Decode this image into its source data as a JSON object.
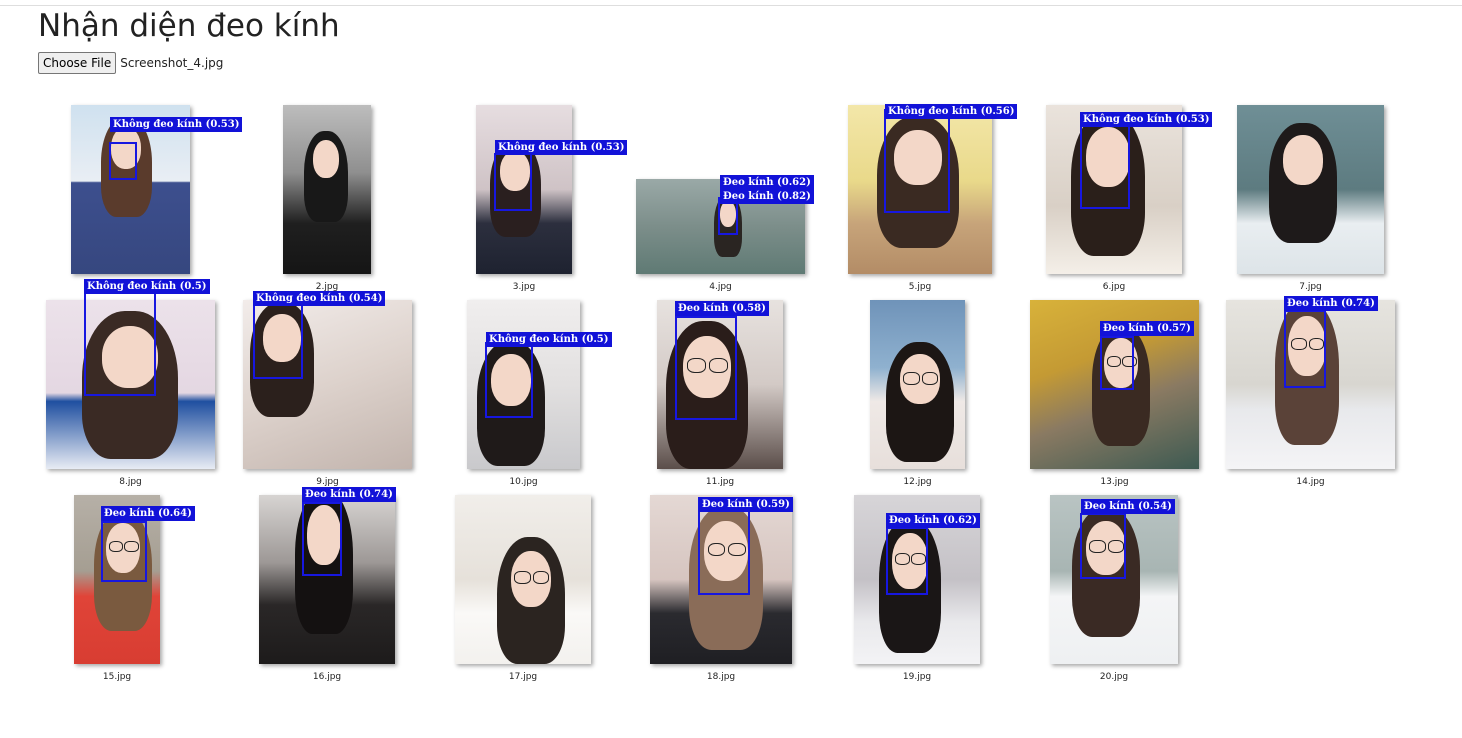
{
  "page": {
    "title": "Nhận diện đeo kính"
  },
  "upload": {
    "button_label": "Choose File",
    "file_name": "Screenshot_4.jpg"
  },
  "results": [
    {
      "caption": "",
      "labels": [
        "Không đeo kính (0.53)"
      ]
    },
    {
      "caption": "2.jpg",
      "labels": []
    },
    {
      "caption": "3.jpg",
      "labels": [
        "Không đeo kính (0.53)"
      ]
    },
    {
      "caption": "4.jpg",
      "labels": [
        "Đeo kính (0.62)",
        "Đeo kính (0.82)"
      ]
    },
    {
      "caption": "5.jpg",
      "labels": [
        "Không đeo kính (0.56)"
      ]
    },
    {
      "caption": "6.jpg",
      "labels": [
        "Không đeo kính (0.53)"
      ]
    },
    {
      "caption": "7.jpg",
      "labels": []
    },
    {
      "caption": "8.jpg",
      "labels": [
        "Không đeo kính (0.5)"
      ]
    },
    {
      "caption": "9.jpg",
      "labels": [
        "Không đeo kính (0.54)"
      ]
    },
    {
      "caption": "10.jpg",
      "labels": [
        "Không đeo kính (0.5)"
      ]
    },
    {
      "caption": "11.jpg",
      "labels": [
        "Đeo kính (0.58)"
      ]
    },
    {
      "caption": "12.jpg",
      "labels": []
    },
    {
      "caption": "13.jpg",
      "labels": [
        "Đeo kính (0.57)"
      ]
    },
    {
      "caption": "14.jpg",
      "labels": [
        "Đeo kính (0.74)"
      ]
    },
    {
      "caption": "15.jpg",
      "labels": [
        "Đeo kính (0.64)"
      ]
    },
    {
      "caption": "16.jpg",
      "labels": [
        "Đeo kính (0.74)"
      ]
    },
    {
      "caption": "17.jpg",
      "labels": []
    },
    {
      "caption": "18.jpg",
      "labels": [
        "Đeo kính (0.59)"
      ]
    },
    {
      "caption": "19.jpg",
      "labels": [
        "Đeo kính (0.62)"
      ]
    },
    {
      "caption": "20.jpg",
      "labels": [
        "Đeo kính (0.54)"
      ]
    }
  ]
}
